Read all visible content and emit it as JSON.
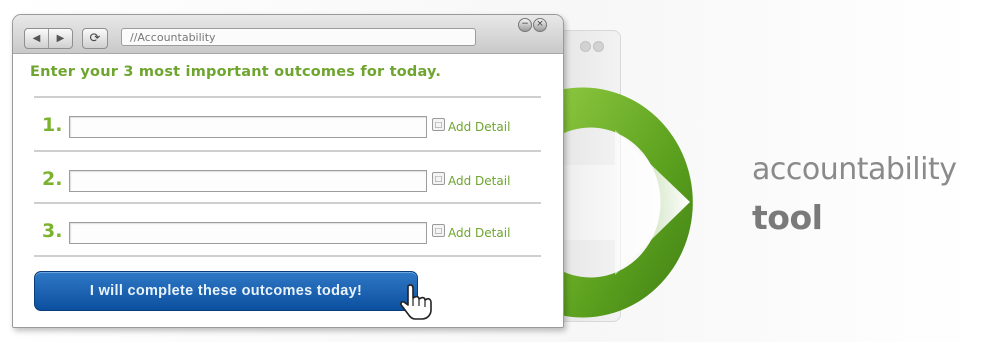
{
  "window": {
    "address": "//Accountability",
    "nav_back_icon": "back-arrow-icon",
    "nav_forward_icon": "forward-arrow-icon",
    "refresh_icon": "refresh-icon",
    "minimize_icon": "minimize-icon",
    "close_icon": "close-icon"
  },
  "form": {
    "heading": "Enter your 3 most important outcomes for today.",
    "rows": [
      {
        "number": "1.",
        "value": "",
        "detail_label": "Add Detail",
        "detail_icon": "note-icon"
      },
      {
        "number": "2.",
        "value": "",
        "detail_label": "Add Detail",
        "detail_icon": "note-icon"
      },
      {
        "number": "3.",
        "value": "",
        "detail_label": "Add Detail",
        "detail_icon": "note-icon"
      }
    ],
    "submit_label": "I will complete these outcomes today!",
    "cursor_icon": "hand-pointer-icon"
  },
  "promo": {
    "line1": "accountability",
    "line2": "tool",
    "graphic_icon": "green-arrow-icon"
  },
  "colors": {
    "accent_green": "#6ea52f",
    "button_blue": "#0c4fa0",
    "tagline_gray": "#8a8a8a"
  }
}
